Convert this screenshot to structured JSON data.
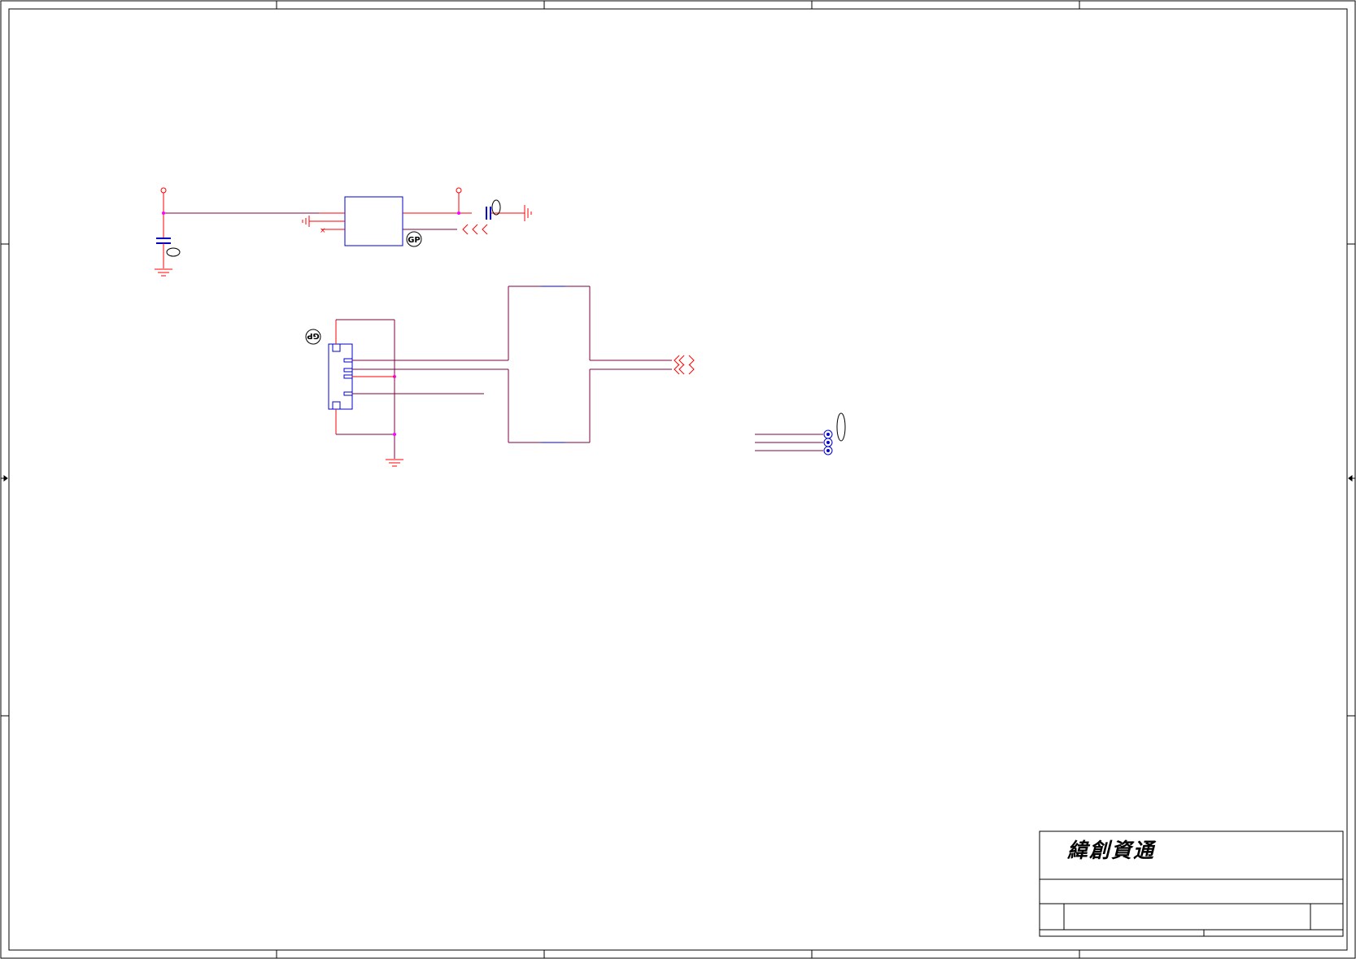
{
  "title_block": {
    "company_name": "緯創資通"
  },
  "markers": {
    "gp_tag": "GP"
  },
  "colors": {
    "wire": "#ff0000",
    "component": "#0000cc",
    "net": "#800040",
    "junction": "#ff00ff",
    "frame": "#000000"
  }
}
